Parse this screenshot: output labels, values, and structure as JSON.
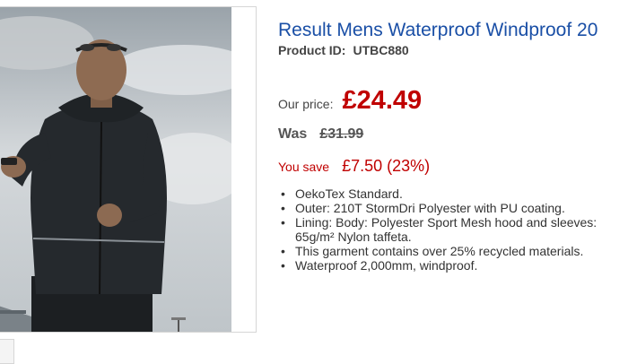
{
  "product": {
    "title": "Result Mens Waterproof Windproof 20",
    "id_label": "Product ID:",
    "id_value": "UTBC880",
    "image_icon": "product-photo-man-in-black-jacket"
  },
  "pricing": {
    "our_price_label": "Our price:",
    "our_price_value": "£24.49",
    "was_label": "Was",
    "was_value": "£31.99",
    "save_label": "You save",
    "save_value": "£7.50 (23%)"
  },
  "features": [
    "OekoTex Standard.",
    "Outer: 210T StormDri Polyester with PU coating.",
    "Lining: Body: Polyester Sport Mesh hood and sleeves: 65g/m² Nylon taffeta.",
    "This garment contains over 25% recycled materials.",
    "Waterproof 2,000mm, windproof."
  ],
  "colors": {
    "title": "#1a4fa6",
    "price": "#c00000",
    "text": "#333333",
    "border": "#d6d6d6"
  }
}
